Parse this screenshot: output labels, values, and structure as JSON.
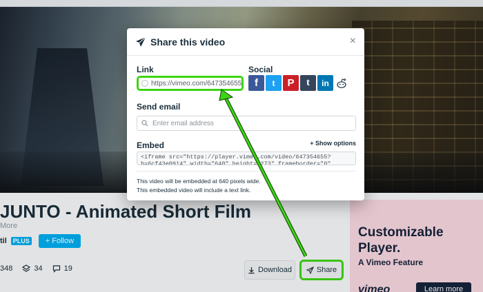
{
  "modal": {
    "title": "Share this video",
    "close": "×",
    "link_label": "Link",
    "link_value": "https://vimeo.com/647354655",
    "social_label": "Social",
    "social_icons": [
      "facebook-icon",
      "twitter-icon",
      "pinterest-icon",
      "tumblr-icon",
      "linkedin-icon",
      "reddit-icon"
    ],
    "social_glyphs": {
      "facebook": "f",
      "twitter": "t",
      "pinterest": "P",
      "tumblr": "t",
      "linkedin": "in"
    },
    "email_label": "Send email",
    "email_placeholder": "Enter email address",
    "embed_label": "Embed",
    "show_options": "+ Show options",
    "embed_code": "<iframe src=\"https://player.vimeo.com/video/647354655?h=6cf43e0914\" width=\"640\" height=\"273\" frameborder=\"0\"",
    "note_1": "This video will be embedded at 640 pixels wide.",
    "note_2": "This embedded video will include a text link."
  },
  "page": {
    "video_title": "JUNTO - Animated Short Film",
    "more": "More",
    "author_fragment": "til",
    "plus_badge": "PLUS",
    "follow_label": "+ Follow",
    "stats": {
      "likes": "348",
      "collections": "34",
      "comments": "19"
    },
    "download_label": "Download",
    "share_label": "Share"
  },
  "ad": {
    "title": "Customizable Player.",
    "subtitle": "A Vimeo Feature",
    "logo": "vimeo",
    "button": "Learn more"
  },
  "colors": {
    "highlight": "#3dd414",
    "vimeo_blue": "#00adef",
    "ad_bg": "#f7d6df"
  }
}
